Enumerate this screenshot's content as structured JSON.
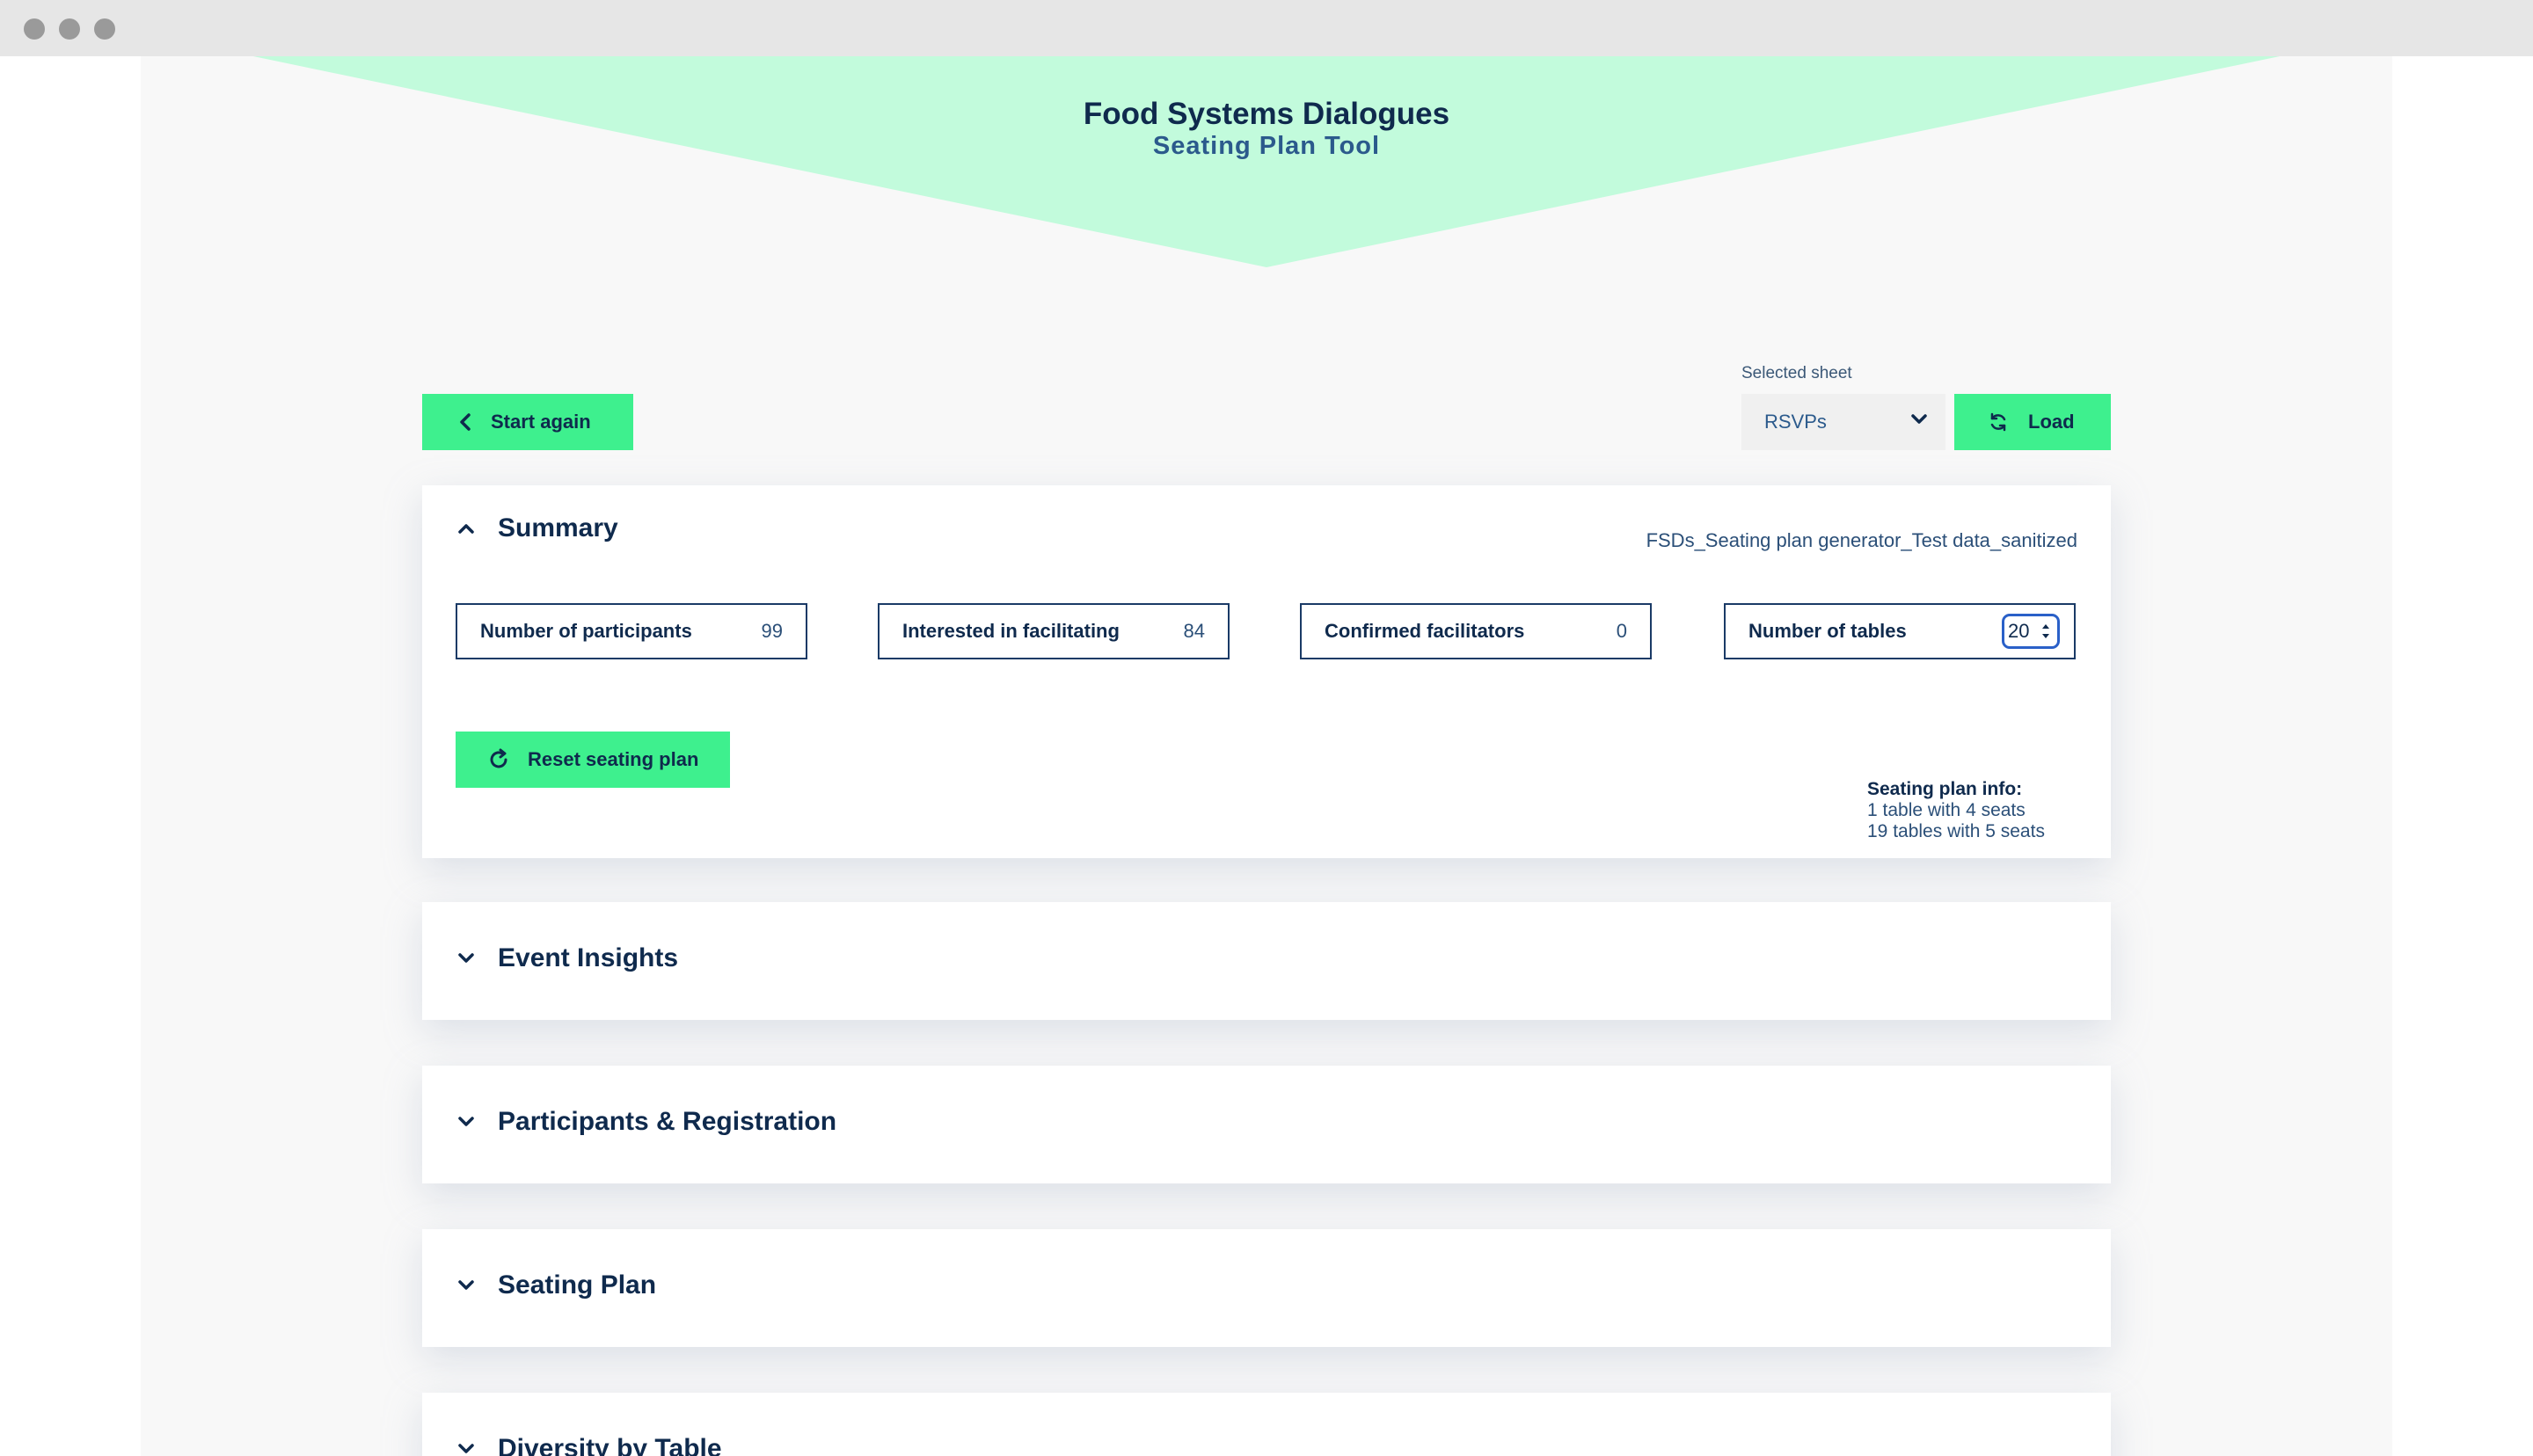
{
  "header": {
    "title": "Food Systems Dialogues",
    "subtitle": "Seating Plan Tool"
  },
  "toolbar": {
    "start_again_label": "Start again",
    "sheet_label": "Selected sheet",
    "sheet_value": "RSVPs",
    "load_label": "Load"
  },
  "summary": {
    "title": "Summary",
    "filename": "FSDs_Seating plan generator_Test data_sanitized",
    "stats": [
      {
        "label": "Number of participants",
        "value": "99"
      },
      {
        "label": "Interested in facilitating",
        "value": "84"
      },
      {
        "label": "Confirmed facilitators",
        "value": "0"
      },
      {
        "label": "Number of tables",
        "value": "20"
      }
    ],
    "reset_label": "Reset seating plan",
    "info": {
      "heading": "Seating plan info:",
      "lines": [
        "1 table with 4 seats",
        "19 tables with 5 seats"
      ]
    }
  },
  "sections": [
    {
      "title": "Event Insights"
    },
    {
      "title": "Participants & Registration"
    },
    {
      "title": "Seating Plan"
    },
    {
      "title": "Diversity by Table"
    }
  ],
  "colors": {
    "accent": "#3ef08e",
    "header_bg": "#c2fbdc",
    "text": "#0f2a4d"
  }
}
